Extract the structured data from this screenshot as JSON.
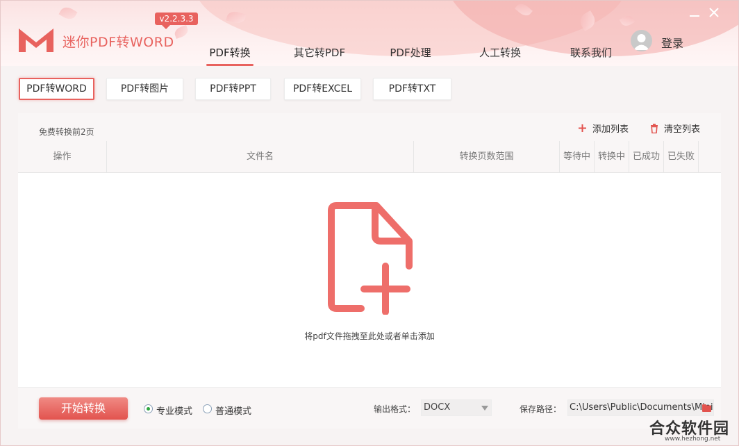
{
  "app": {
    "title": "迷你PDF转WORD",
    "version": "v2.2.3.3",
    "login_label": "登录"
  },
  "nav_tabs": [
    {
      "label": "PDF转换",
      "active": true
    },
    {
      "label": "其它转PDF",
      "active": false
    },
    {
      "label": "PDF处理",
      "active": false
    },
    {
      "label": "人工转换",
      "active": false
    },
    {
      "label": "联系我们",
      "active": false
    }
  ],
  "sub_tabs": [
    {
      "label": "PDF转WORD",
      "active": true
    },
    {
      "label": "PDF转图片",
      "active": false
    },
    {
      "label": "PDF转PPT",
      "active": false
    },
    {
      "label": "PDF转EXCEL",
      "active": false
    },
    {
      "label": "PDF转TXT",
      "active": false
    }
  ],
  "panel": {
    "free_note": "免费转换前2页",
    "add_list": "添加列表",
    "clear_list": "清空列表",
    "columns": [
      "操作",
      "文件名",
      "转换页数范围",
      "等待中",
      "转换中",
      "已成功",
      "已失败"
    ],
    "drop_hint": "将pdf文件拖拽至此处或者单击添加"
  },
  "bottom": {
    "start_button": "开始转换",
    "mode_pro": "专业模式",
    "mode_normal": "普通模式",
    "selected_mode": "专业模式",
    "format_label": "输出格式：",
    "format_value": "DOCX",
    "path_label": "保存路径：",
    "path_value": "C:\\Users\\Public\\Documents\\Mini"
  },
  "watermark": {
    "name": "合众软件园",
    "url": "www.hezhong.net"
  },
  "colors": {
    "accent": "#e8625e",
    "radio_selected": "#2fa640"
  },
  "icons": [
    "logo-icon",
    "avatar-icon",
    "minimize-icon",
    "close-icon",
    "plus-icon",
    "trash-icon",
    "add-file-icon",
    "folder-icon"
  ]
}
